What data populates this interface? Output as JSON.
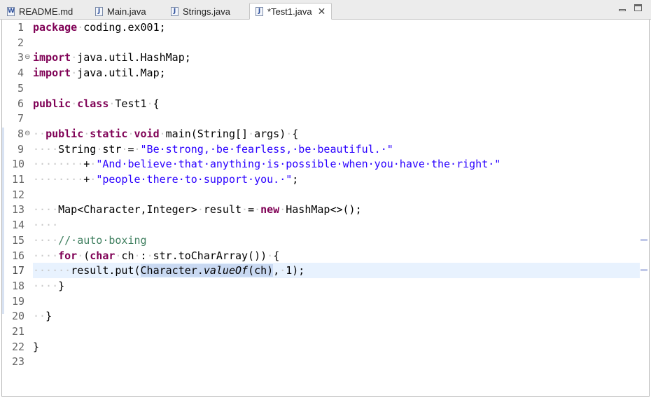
{
  "tabs": [
    {
      "label": "README.md",
      "icon": "W",
      "icon_name": "wiki-file-icon"
    },
    {
      "label": "Main.java",
      "icon": "J",
      "icon_name": "java-file-icon"
    },
    {
      "label": "Strings.java",
      "icon": "J",
      "icon_name": "java-file-icon"
    },
    {
      "label": "*Test1.java",
      "icon": "J",
      "icon_name": "java-file-icon",
      "active": true
    }
  ],
  "window_controls": {
    "minimize": "minimize-icon",
    "maximize": "maximize-icon"
  },
  "editor": {
    "current_line": 17,
    "line_numbers": [
      "1",
      "2",
      "3",
      "4",
      "5",
      "6",
      "7",
      "8",
      "9",
      "10",
      "11",
      "12",
      "13",
      "14",
      "15",
      "16",
      "17",
      "18",
      "19",
      "20",
      "21",
      "22",
      "23"
    ],
    "lines": [
      {
        "n": 1,
        "parts": [
          [
            "kw",
            "package"
          ],
          [
            "ws",
            "·"
          ],
          [
            "",
            "coding.ex001;"
          ]
        ]
      },
      {
        "n": 2,
        "parts": []
      },
      {
        "n": 3,
        "parts": [
          [
            "kw",
            "import"
          ],
          [
            "ws",
            "·"
          ],
          [
            "",
            "java.util.HashMap;"
          ]
        ]
      },
      {
        "n": 4,
        "parts": [
          [
            "kw",
            "import"
          ],
          [
            "ws",
            "·"
          ],
          [
            "",
            "java.util.Map;"
          ]
        ]
      },
      {
        "n": 5,
        "parts": []
      },
      {
        "n": 6,
        "parts": [
          [
            "kw",
            "public"
          ],
          [
            "ws",
            "·"
          ],
          [
            "kw",
            "class"
          ],
          [
            "ws",
            "·"
          ],
          [
            "",
            "Test1"
          ],
          [
            "ws",
            "·"
          ],
          [
            "",
            "{"
          ]
        ]
      },
      {
        "n": 7,
        "parts": []
      },
      {
        "n": 8,
        "parts": [
          [
            "ws",
            "··"
          ],
          [
            "kw",
            "public"
          ],
          [
            "ws",
            "·"
          ],
          [
            "kw",
            "static"
          ],
          [
            "ws",
            "·"
          ],
          [
            "kw",
            "void"
          ],
          [
            "ws",
            "·"
          ],
          [
            "",
            "main(String[]"
          ],
          [
            "ws",
            "·"
          ],
          [
            "",
            "args)"
          ],
          [
            "ws",
            "·"
          ],
          [
            "",
            "{"
          ]
        ]
      },
      {
        "n": 9,
        "parts": [
          [
            "ws",
            "····"
          ],
          [
            "",
            "String"
          ],
          [
            "ws",
            "·"
          ],
          [
            "",
            "str"
          ],
          [
            "ws",
            "·"
          ],
          [
            "",
            "="
          ],
          [
            "ws",
            "·"
          ],
          [
            "str",
            "\"Be·strong,·be·fearless,·be·beautiful.·\""
          ]
        ]
      },
      {
        "n": 10,
        "parts": [
          [
            "ws",
            "········"
          ],
          [
            "",
            "+"
          ],
          [
            "ws",
            "·"
          ],
          [
            "str",
            "\"And·believe·that·anything·is·possible·when·you·have·the·right·\""
          ]
        ]
      },
      {
        "n": 11,
        "parts": [
          [
            "ws",
            "········"
          ],
          [
            "",
            "+"
          ],
          [
            "ws",
            "·"
          ],
          [
            "str",
            "\"people·there·to·support·you.·\""
          ],
          [
            "",
            ";"
          ]
        ]
      },
      {
        "n": 12,
        "parts": []
      },
      {
        "n": 13,
        "parts": [
          [
            "ws",
            "····"
          ],
          [
            "",
            "Map<Character,Integer>"
          ],
          [
            "ws",
            "·"
          ],
          [
            "",
            "result"
          ],
          [
            "ws",
            "·"
          ],
          [
            "",
            "="
          ],
          [
            "ws",
            "·"
          ],
          [
            "kw",
            "new"
          ],
          [
            "ws",
            "·"
          ],
          [
            "",
            "HashMap<>();"
          ]
        ]
      },
      {
        "n": 14,
        "parts": [
          [
            "ws",
            "····"
          ]
        ]
      },
      {
        "n": 15,
        "parts": [
          [
            "ws",
            "····"
          ],
          [
            "cmt",
            "//·auto·boxing"
          ]
        ]
      },
      {
        "n": 16,
        "parts": [
          [
            "ws",
            "····"
          ],
          [
            "kw",
            "for"
          ],
          [
            "ws",
            "·"
          ],
          [
            "",
            "("
          ],
          [
            "kw",
            "char"
          ],
          [
            "ws",
            "·"
          ],
          [
            "",
            "ch"
          ],
          [
            "ws",
            "·"
          ],
          [
            "",
            ":"
          ],
          [
            "ws",
            "·"
          ],
          [
            "",
            "str.toCharArray())"
          ],
          [
            "ws",
            "·"
          ],
          [
            "",
            "{"
          ]
        ]
      },
      {
        "n": 17,
        "parts": [
          [
            "ws",
            "······"
          ],
          [
            "",
            "result.put("
          ],
          [
            "caret",
            ""
          ],
          [
            "sel",
            "Character."
          ],
          [
            "sel ital",
            "valueOf"
          ],
          [
            "sel",
            "(ch)"
          ],
          [
            "",
            ","
          ],
          [
            "ws",
            "·"
          ],
          [
            "",
            "1);"
          ]
        ]
      },
      {
        "n": 18,
        "parts": [
          [
            "ws",
            "····"
          ],
          [
            "",
            "}"
          ]
        ]
      },
      {
        "n": 19,
        "parts": []
      },
      {
        "n": 20,
        "parts": [
          [
            "ws",
            "··"
          ],
          [
            "",
            "}"
          ]
        ]
      },
      {
        "n": 21,
        "parts": []
      },
      {
        "n": 22,
        "parts": [
          [
            "",
            "}"
          ]
        ]
      },
      {
        "n": 23,
        "parts": []
      }
    ],
    "fold_lines": [
      3,
      8
    ],
    "fold_icon": "collapse-icon",
    "overview_marks": [
      15,
      17
    ]
  },
  "colors": {
    "keyword": "#7f0055",
    "string": "#2a00ff",
    "comment": "#3f7f5f",
    "current_line": "#e8f2fe",
    "selection": "#c9d9f2"
  }
}
